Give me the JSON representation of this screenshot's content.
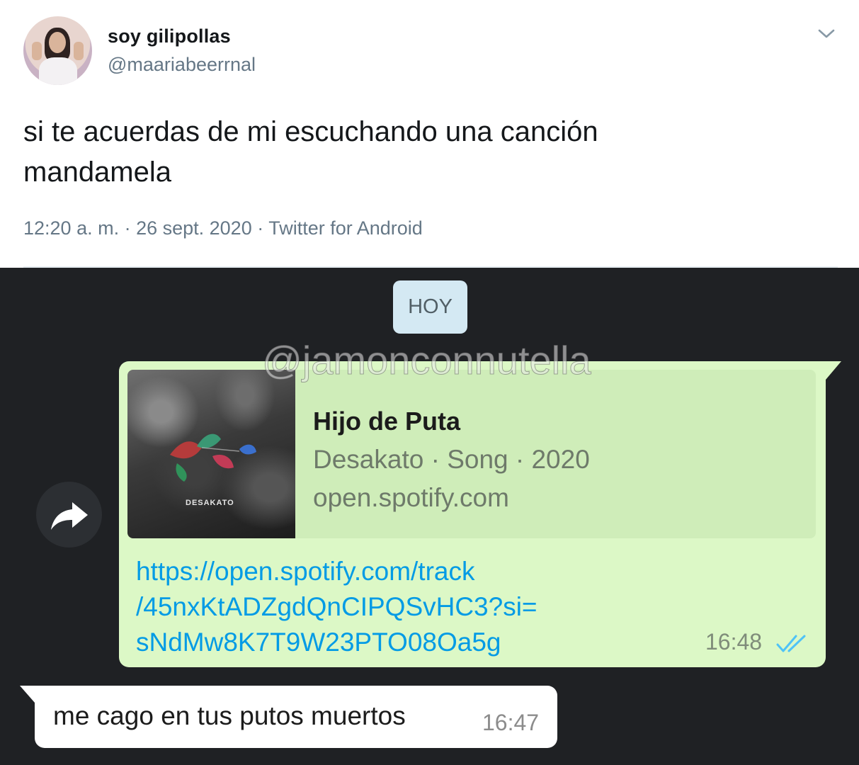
{
  "tweet": {
    "display_name": "soy gilipollas",
    "handle": "@maariabeerrnal",
    "text_line1": "si te acuerdas de mi escuchando una canción",
    "text_line2": "mandamela",
    "meta": "12:20 a. m. · 26 sept. 2020 · Twitter for Android"
  },
  "chat": {
    "date_label": "HOY",
    "watermark": "@jamonconnutella",
    "outgoing": {
      "preview": {
        "title": "Hijo de Puta",
        "subtitle": "Desakato · Song · 2020",
        "domain": "open.spotify.com",
        "cover_text": "DESAKATO"
      },
      "link_lines": [
        "https://open.spotify.com/track",
        "/45nxKtADZgdQnCIPQSvHC3?si=",
        "sNdMw8K7T9W23PTO08Oa5g"
      ],
      "time": "16:48",
      "status_icon": "double-check-icon"
    },
    "incoming": {
      "text": "me cago en tus putos muertos",
      "time": "16:47"
    }
  },
  "colors": {
    "tweet_text": "#14171a",
    "tweet_secondary": "#657786",
    "chat_background": "#1f2124",
    "outgoing_bubble": "#dcf8c6",
    "link": "#039be5",
    "date_pill": "#d4e9f3",
    "read_ticks": "#4fc3f7"
  }
}
